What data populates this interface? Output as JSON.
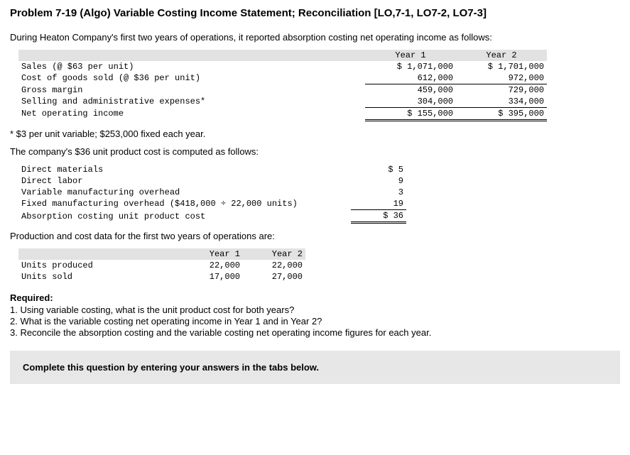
{
  "title": "Problem 7-19 (Algo) Variable Costing Income Statement; Reconciliation [LO,7-1, LO7-2, LO7-3]",
  "intro": "During Heaton Company's first two years of operations, it reported absorption costing net operating income as follows:",
  "income_stmt": {
    "headers": [
      "Year 1",
      "Year 2"
    ],
    "rows": [
      {
        "label": "Sales (@ $63 per unit)",
        "y1": "$ 1,071,000",
        "y2": "$ 1,701,000"
      },
      {
        "label": "Cost of goods sold (@ $36 per unit)",
        "y1": "612,000",
        "y2": "972,000"
      },
      {
        "label": "Gross margin",
        "y1": "459,000",
        "y2": "729,000"
      },
      {
        "label": "Selling and administrative expenses*",
        "y1": "304,000",
        "y2": "334,000"
      },
      {
        "label": "Net operating income",
        "y1": "$ 155,000",
        "y2": "$ 395,000"
      }
    ]
  },
  "footnote": "* $3 per unit variable; $253,000 fixed each year.",
  "cost_intro": "The company's $36 unit product cost is computed as follows:",
  "cost_rows": [
    {
      "label": "Direct materials",
      "v": "$ 5"
    },
    {
      "label": "Direct labor",
      "v": "9"
    },
    {
      "label": "Variable manufacturing overhead",
      "v": "3"
    },
    {
      "label": "Fixed manufacturing overhead ($418,000 ÷ 22,000 units)",
      "v": "19"
    },
    {
      "label": "Absorption costing unit product cost",
      "v": "$ 36"
    }
  ],
  "prod_intro": "Production and cost data for the first two years of operations are:",
  "prod": {
    "headers": [
      "Year 1",
      "Year 2"
    ],
    "rows": [
      {
        "label": "Units produced",
        "y1": "22,000",
        "y2": "22,000"
      },
      {
        "label": "Units sold",
        "y1": "17,000",
        "y2": "27,000"
      }
    ]
  },
  "required_heading": "Required:",
  "requirements": [
    "1. Using variable costing, what is the unit product cost for both years?",
    "2. What is the variable costing net operating income in Year 1 and in Year 2?",
    "3. Reconcile the absorption costing and the variable costing net operating income figures for each year."
  ],
  "banner": "Complete this question by entering your answers in the tabs below."
}
